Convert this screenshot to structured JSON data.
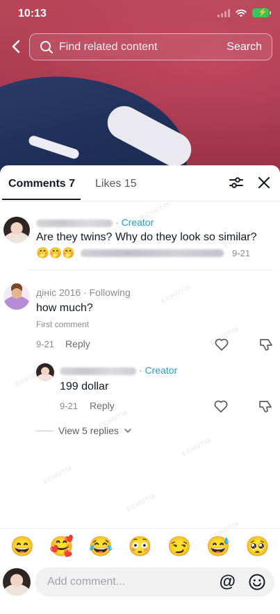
{
  "status_bar": {
    "time": "10:13"
  },
  "search": {
    "placeholder": "Find related content",
    "button": "Search"
  },
  "tabs": {
    "comments": "Comments 7",
    "likes": "Likes 15"
  },
  "comments": [
    {
      "author_label": "Creator",
      "text": "Are they twins? Why do they look so similar?",
      "emojis": "🤭🤭🤭",
      "date": "9-21"
    },
    {
      "author": "дініс 2016",
      "relation": "Following",
      "text": "how much?",
      "note": "First comment",
      "date": "9-21",
      "reply": "Reply",
      "replies": [
        {
          "author_label": "Creator",
          "text": "199 dollar",
          "date": "9-21",
          "reply": "Reply"
        }
      ],
      "view_replies": "View 5 replies"
    }
  ],
  "emoji_bar": [
    "😄",
    "🥰",
    "😂",
    "😳",
    "😏",
    "😅",
    "🥺"
  ],
  "composer": {
    "placeholder": "Add comment..."
  },
  "colors": {
    "creator": "#2a9dbf",
    "accent_battery": "#34c759"
  }
}
